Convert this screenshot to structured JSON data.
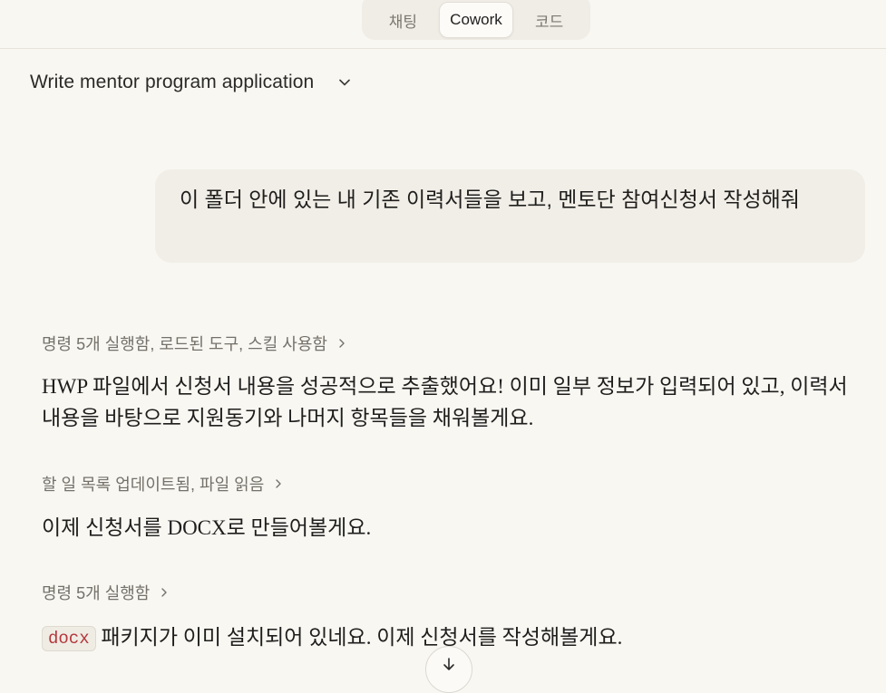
{
  "mode_tabs": [
    {
      "label": "채팅",
      "active": false
    },
    {
      "label": "Cowork",
      "active": true
    },
    {
      "label": "코드",
      "active": false
    }
  ],
  "conversation": {
    "title": "Write mentor program application"
  },
  "user_message": "이 폴더 안에 있는 내 기존 이력서들을 보고, 멘토단 참여신청서 작성해줘",
  "steps": [
    {
      "summary": "명령 5개 실행함, 로드된 도구, 스킬 사용함"
    },
    {
      "summary": "할 일 목록 업데이트됨, 파일 읽음"
    },
    {
      "summary": "명령 5개 실행함"
    }
  ],
  "replies": [
    {
      "text": "HWP 파일에서 신청서 내용을 성공적으로 추출했어요! 이미 일부 정보가 입력되어 있고, 이력서 내용을 바탕으로 지원동기와 나머지 항목들을 채워볼게요."
    },
    {
      "text": "이제 신청서를 DOCX로 만들어볼게요."
    },
    {
      "code": "docx",
      "text": " 패키지가 이미 설치되어 있네요. 이제 신청서를 작성해볼게요."
    }
  ],
  "icons": {
    "title_dropdown": "chevron-down-icon",
    "step_expand": "chevron-right-icon",
    "scroll_down": "arrow-down-icon"
  },
  "colors": {
    "background": "#f8f7f2",
    "user_bubble": "#f0eee6",
    "inline_code": "#b3373b",
    "muted_text": "#74716a"
  }
}
